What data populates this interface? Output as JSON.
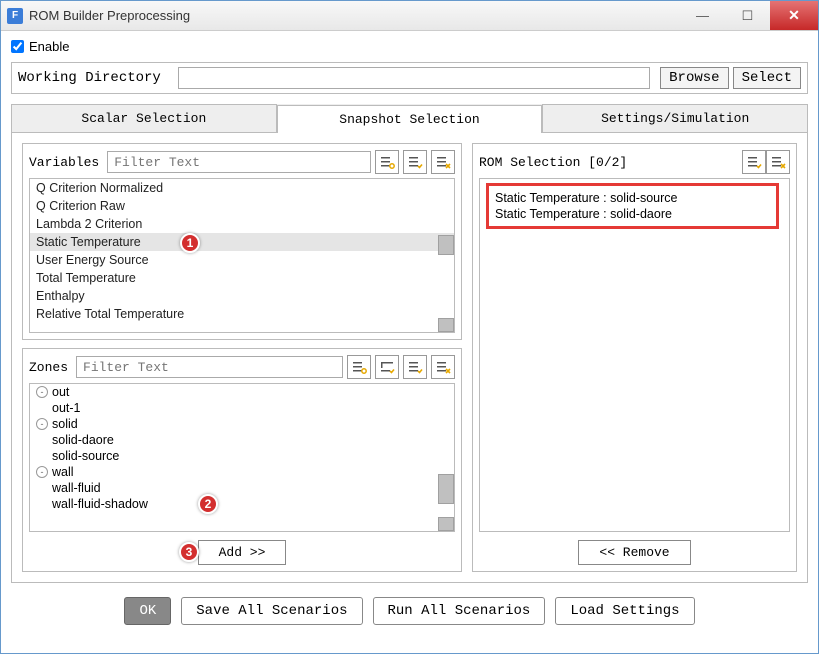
{
  "window": {
    "title": "ROM Builder Preprocessing",
    "app_icon_letter": "F"
  },
  "enable": {
    "label": "Enable",
    "checked": true
  },
  "working_dir": {
    "label": "Working Directory",
    "value": "",
    "browse": "Browse",
    "select": "Select"
  },
  "tabs": {
    "scalar": "Scalar Selection",
    "snapshot": "Snapshot Selection",
    "settings": "Settings/Simulation"
  },
  "variables": {
    "label": "Variables",
    "filter_placeholder": "Filter Text",
    "items": [
      "Q Criterion Normalized",
      "Q Criterion Raw",
      "Lambda 2 Criterion",
      "Static Temperature",
      "User Energy Source",
      "Total Temperature",
      "Enthalpy",
      "Relative Total Temperature"
    ],
    "selected_index": 3
  },
  "zones": {
    "label": "Zones",
    "filter_placeholder": "Filter Text",
    "tree": [
      {
        "label": "out",
        "depth": 0,
        "expand": "-"
      },
      {
        "label": "out-1",
        "depth": 1
      },
      {
        "label": "solid",
        "depth": 0,
        "expand": "-"
      },
      {
        "label": "solid-daore",
        "depth": 1
      },
      {
        "label": "solid-source",
        "depth": 1
      },
      {
        "label": "wall",
        "depth": 0,
        "expand": "-",
        "selected": true
      },
      {
        "label": "wall-fluid",
        "depth": 1
      },
      {
        "label": "wall-fluid-shadow",
        "depth": 1
      }
    ]
  },
  "add_button": "Add   >>",
  "remove_button": "<<  Remove",
  "rom_selection": {
    "label": "ROM Selection [0/2]",
    "items": [
      "Static Temperature : solid-source",
      "Static Temperature : solid-daore"
    ]
  },
  "footer": {
    "ok": "OK",
    "save_all": "Save All Scenarios",
    "run_all": "Run All Scenarios",
    "load": "Load Settings"
  },
  "annotations": {
    "a1": "1",
    "a2": "2",
    "a3": "3"
  }
}
